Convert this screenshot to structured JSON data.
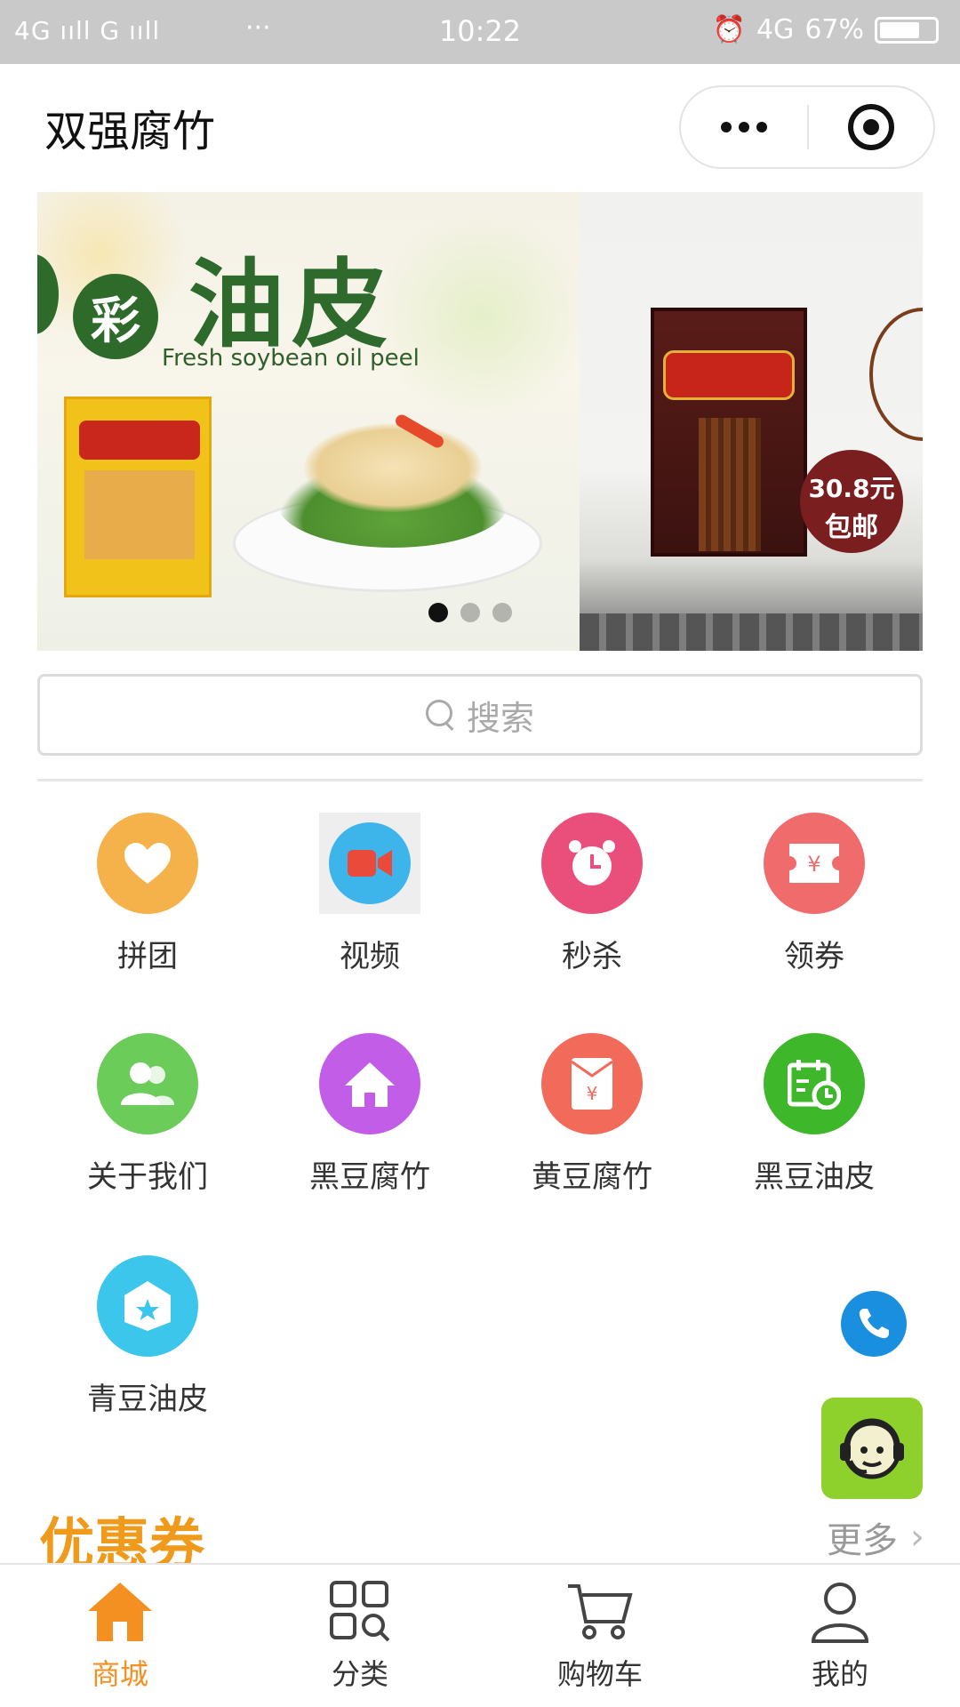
{
  "status_bar": {
    "network": "4G ııll G ııll",
    "dots": "···",
    "time": "10:22",
    "alarm_icon": "alarm-icon",
    "signal": "4G",
    "battery": "67%"
  },
  "header": {
    "title": "双强腐竹",
    "more_icon": "more-dots-icon",
    "close_icon": "target-close-icon"
  },
  "banner": {
    "slide1": {
      "badge": "彩",
      "headline": "油皮",
      "subtitle": "Fresh soybean oil peel"
    },
    "slide2": {
      "price_line1": "30.8元",
      "price_line2": "包邮"
    },
    "dots": [
      true,
      false,
      false
    ]
  },
  "search": {
    "placeholder": "搜索",
    "icon": "search-icon"
  },
  "categories": [
    {
      "label": "拼团",
      "icon": "heart-icon",
      "color": "#f5b14a"
    },
    {
      "label": "视频",
      "icon": "video-camera-icon",
      "color": "#3db4ea"
    },
    {
      "label": "秒杀",
      "icon": "alarm-clock-icon",
      "color": "#ea4f7c"
    },
    {
      "label": "领券",
      "icon": "coupon-ticket-icon",
      "color": "#f06c6c"
    },
    {
      "label": "关于我们",
      "icon": "users-icon",
      "color": "#6ccc5a"
    },
    {
      "label": "黑豆腐竹",
      "icon": "home-icon",
      "color": "#c25de8"
    },
    {
      "label": "黄豆腐竹",
      "icon": "red-envelope-icon",
      "color": "#f26a5a"
    },
    {
      "label": "黑豆油皮",
      "icon": "calendar-clock-icon",
      "color": "#3fb72a"
    },
    {
      "label": "青豆油皮",
      "icon": "star-bag-icon",
      "color": "#3dc6ec"
    }
  ],
  "floating": {
    "phone_icon": "phone-icon",
    "service_icon": "customer-service-icon"
  },
  "coupon_section": {
    "title": "优惠券",
    "more": "更多",
    "more_icon": "chevron-right-icon"
  },
  "tabbar": [
    {
      "label": "商城",
      "icon": "home-tab-icon",
      "active": true
    },
    {
      "label": "分类",
      "icon": "category-grid-icon",
      "active": false
    },
    {
      "label": "购物车",
      "icon": "cart-icon",
      "active": false
    },
    {
      "label": "我的",
      "icon": "user-icon",
      "active": false
    }
  ],
  "colors": {
    "accent": "#f49022",
    "coupon_title": "#f09a1c",
    "status_bar": "#c9c9c9"
  }
}
